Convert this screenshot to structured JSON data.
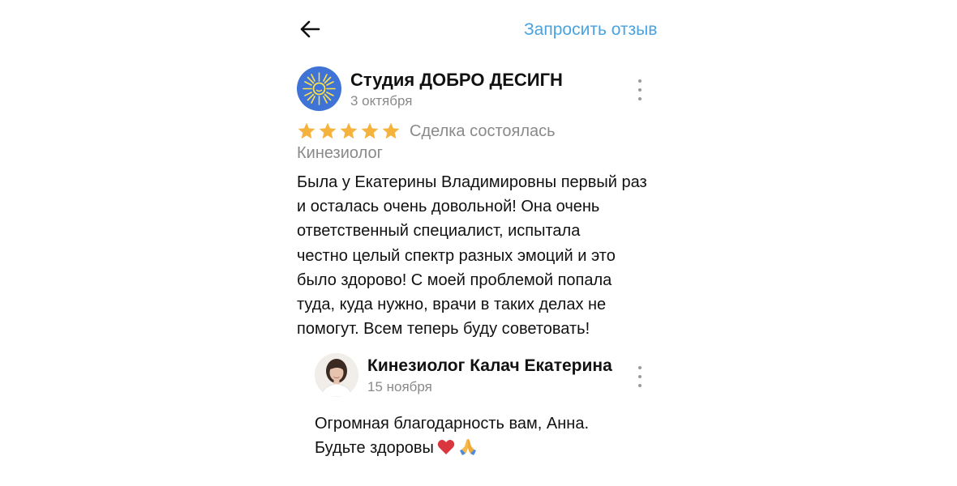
{
  "header": {
    "back_icon": "arrow-left-icon",
    "request_review_label": "Запросить отзыв",
    "accent_color": "#4aa3e0"
  },
  "review": {
    "author": "Студия ДОБРО ДЕСИГН",
    "date": "3 октября",
    "avatar_icon": "sun-logo-icon",
    "avatar_color": "#3f73d6",
    "rating": 5,
    "rating_max": 5,
    "star_color": "#f5b23c",
    "deal_status": "Сделка состоялась",
    "category": "Кинезиолог",
    "text_lines": [
      "Была у Екатерины Владимировны первый раз",
      "и осталась очень довольной! Она очень",
      "ответственный специалист, испытала",
      "честно целый спектр разных эмоций и это",
      "было здорово! С моей проблемой попала",
      "туда, куда нужно, врачи в таких делах не",
      "помогут. Всем теперь буду советовать!"
    ],
    "more_icon": "more-vertical-icon"
  },
  "reply": {
    "author": "Кинезиолог Калач Екатерина",
    "date": "15 ноября",
    "avatar_icon": "user-photo-icon",
    "text_lines": [
      "Огромная благодарность вам, Анна.",
      "Будьте здоровы"
    ],
    "emoji_icons": [
      "heart-icon",
      "praying-hands-icon"
    ],
    "more_icon": "more-vertical-icon"
  }
}
